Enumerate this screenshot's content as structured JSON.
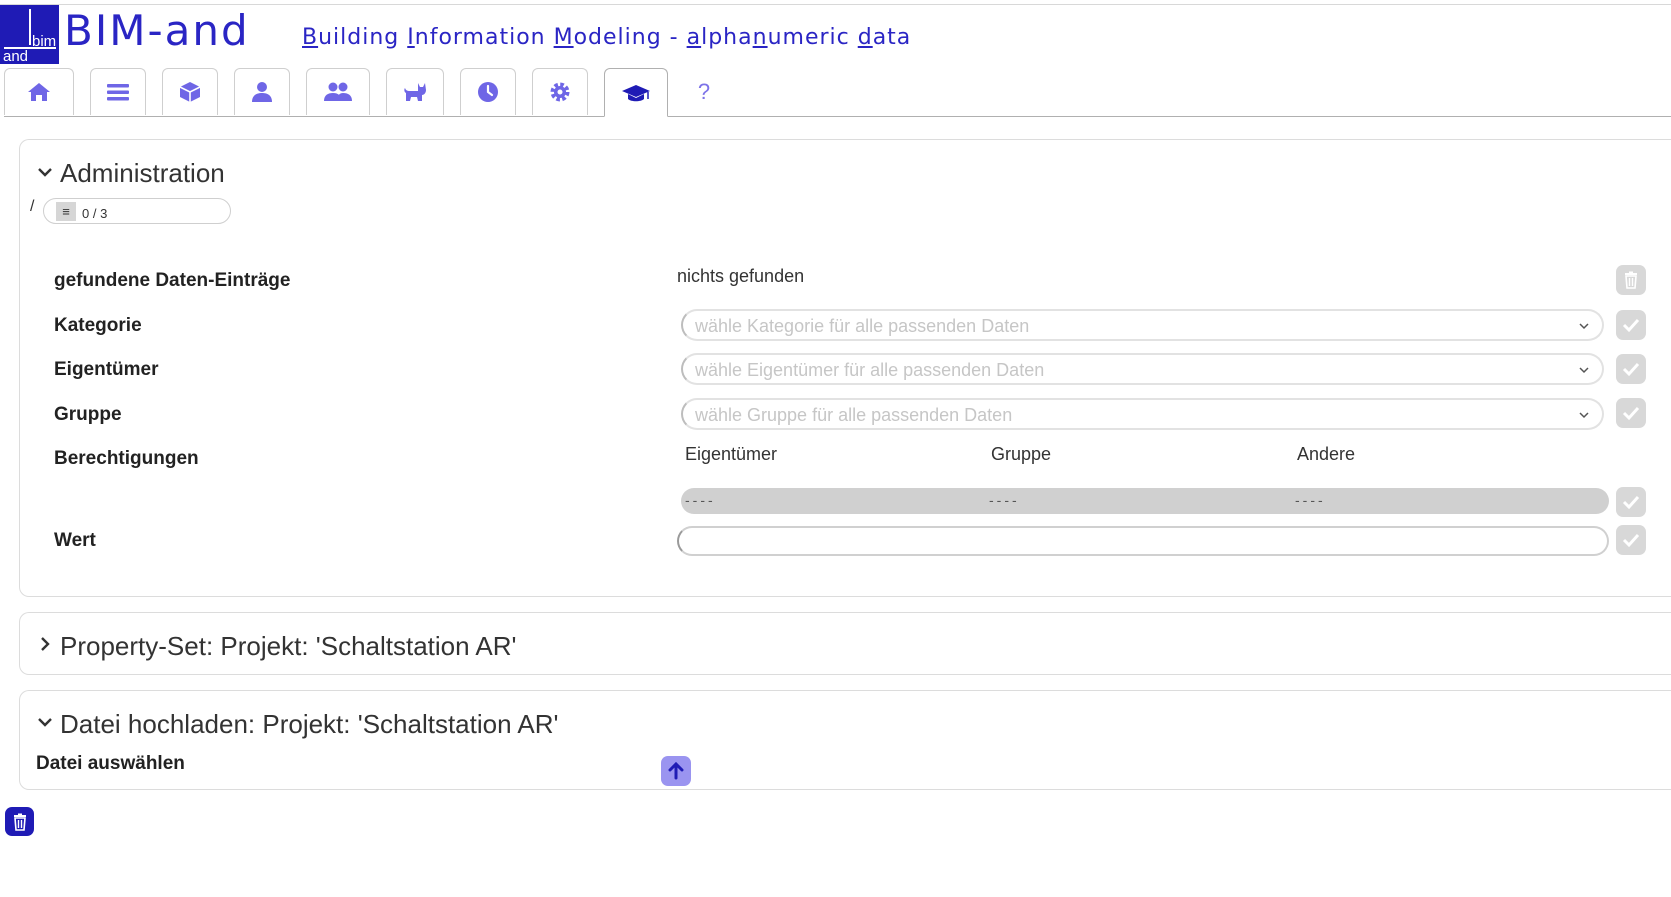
{
  "header": {
    "logo_top": "bim",
    "logo_bottom": "and",
    "brand": "BIM-and",
    "subtitle_parts": [
      "B",
      "uilding ",
      "I",
      "nformation ",
      "M",
      "odeling - ",
      "a",
      "lpha",
      "n",
      "umeric ",
      "d",
      "ata"
    ]
  },
  "tabs": [
    {
      "icon": "home-icon"
    },
    {
      "icon": "list-icon"
    },
    {
      "icon": "cube-icon"
    },
    {
      "icon": "user-icon"
    },
    {
      "icon": "users-icon"
    },
    {
      "icon": "cat-icon"
    },
    {
      "icon": "clock-icon"
    },
    {
      "icon": "gear-icon"
    },
    {
      "icon": "graduation-cap-icon",
      "active": true
    },
    {
      "label": "?"
    }
  ],
  "admin": {
    "title": "Administration",
    "path": "/",
    "counter": "0 / 3",
    "rows": {
      "found_label": "gefundene Daten-Einträge",
      "found_value": "nichts gefunden",
      "kategorie_label": "Kategorie",
      "kategorie_placeholder": "wähle Kategorie für alle passenden Daten",
      "eigentuemer_label": "Eigentümer",
      "eigentuemer_placeholder": "wähle Eigentümer für alle passenden Daten",
      "gruppe_label": "Gruppe",
      "gruppe_placeholder": "wähle Gruppe für alle passenden Daten",
      "berechtigungen_label": "Berechtigungen",
      "perm_headers": [
        "Eigentümer",
        "Gruppe",
        "Andere"
      ],
      "perm_values": [
        "----",
        "----",
        "----"
      ],
      "wert_label": "Wert",
      "wert_value": ""
    }
  },
  "property_set": {
    "title": "Property-Set: Projekt: 'Schaltstation AR'"
  },
  "upload": {
    "title": "Datei hochladen: Projekt: 'Schaltstation AR'",
    "label": "Datei auswählen"
  },
  "colors": {
    "brand": "#2a25c4",
    "logo_bg": "#1f1bb5",
    "icon": "#6f66e6",
    "active_icon": "#1f1bb5",
    "upload_button": "#9a94f0"
  }
}
